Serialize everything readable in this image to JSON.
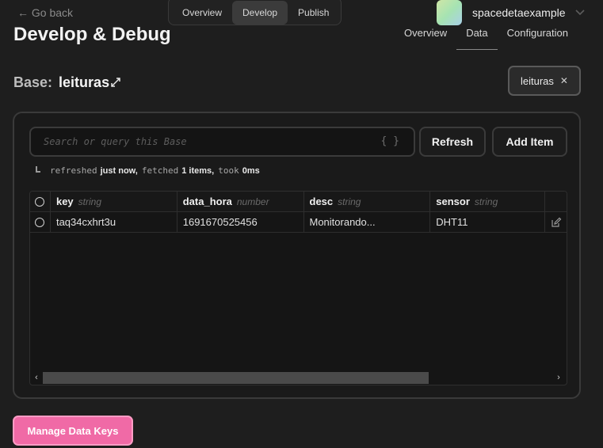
{
  "header": {
    "back_label": "← Go back",
    "tabs": [
      {
        "label": "Overview"
      },
      {
        "label": "Develop"
      },
      {
        "label": "Publish"
      }
    ],
    "profile_name": "spacedetaexample"
  },
  "page": {
    "title": "Develop & Debug",
    "subtabs": [
      {
        "label": "Overview"
      },
      {
        "label": "Data"
      },
      {
        "label": "Configuration"
      }
    ],
    "base_prefix": "Base:",
    "base_name": "leituras",
    "base_chip": "leituras"
  },
  "query": {
    "placeholder": "Search or query this Base",
    "refresh_label": "Refresh",
    "add_label": "Add Item",
    "status": {
      "refreshed": "refreshed",
      "when": "just now,",
      "fetched": "fetched",
      "count": "1 items,",
      "took": "took",
      "duration": "0ms"
    }
  },
  "table": {
    "columns": [
      {
        "name": "key",
        "type": "string"
      },
      {
        "name": "data_hora",
        "type": "number"
      },
      {
        "name": "desc",
        "type": "string"
      },
      {
        "name": "sensor",
        "type": "string"
      }
    ],
    "rows": [
      {
        "key": "taq34cxhrt3u",
        "data_hora": "1691670525456",
        "desc": "Monitorando...",
        "sensor": "DHT11"
      }
    ]
  },
  "footer": {
    "manage_label": "Manage Data Keys"
  },
  "colors": {
    "accent": "#f06aa6",
    "background": "#1e1e1e"
  }
}
